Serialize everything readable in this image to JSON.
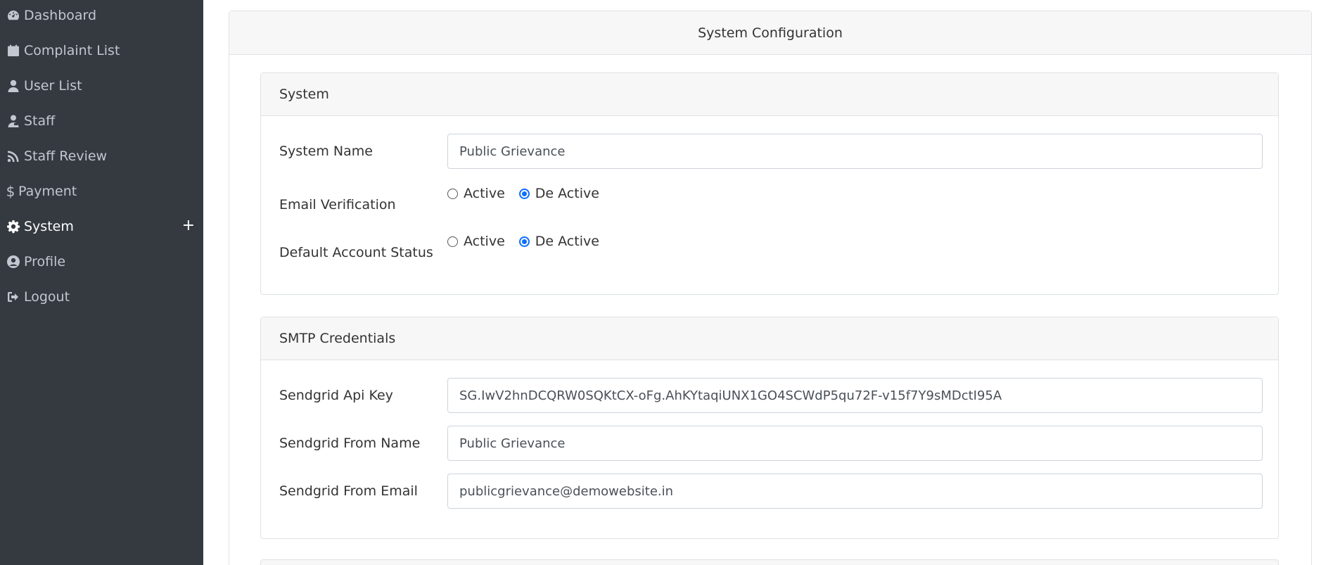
{
  "sidebar": {
    "items": [
      {
        "label": "Dashboard",
        "icon": "dashboard-icon"
      },
      {
        "label": "Complaint List",
        "icon": "calendar-icon"
      },
      {
        "label": "User List",
        "icon": "user-icon"
      },
      {
        "label": "Staff",
        "icon": "staff-icon"
      },
      {
        "label": "Staff Review",
        "icon": "rss-icon"
      },
      {
        "label": "Payment",
        "icon": "dollar-icon"
      },
      {
        "label": "System",
        "icon": "gear-icon",
        "active": true,
        "expand": "+"
      },
      {
        "label": "Profile",
        "icon": "user-circle-icon"
      },
      {
        "label": "Logout",
        "icon": "logout-icon"
      }
    ]
  },
  "main": {
    "title": "System Configuration",
    "system_section": {
      "title": "System",
      "system_name_label": "System Name",
      "system_name_value": "Public Grievance",
      "email_verification_label": "Email Verification",
      "email_verification_options": [
        "Active",
        "De Active"
      ],
      "email_verification_selected": "De Active",
      "default_account_status_label": "Default Account Status",
      "default_account_status_options": [
        "Active",
        "De Active"
      ],
      "default_account_status_selected": "De Active"
    },
    "smtp_section": {
      "title": "SMTP Credentials",
      "api_key_label": "Sendgrid Api Key",
      "api_key_value": "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",
      "from_name_label": "Sendgrid From Name",
      "from_name_value": "Public Grievance",
      "from_email_label": "Sendgrid From Email",
      "from_email_value": "publicgrievance@demowebsite.in"
    }
  },
  "colors": {
    "sidebar_bg": "#343a40",
    "sidebar_text": "#c2c7d0",
    "sidebar_active_text": "#ffffff",
    "card_header_bg": "#f7f7f7",
    "radio_checked": "#0d6efd"
  }
}
